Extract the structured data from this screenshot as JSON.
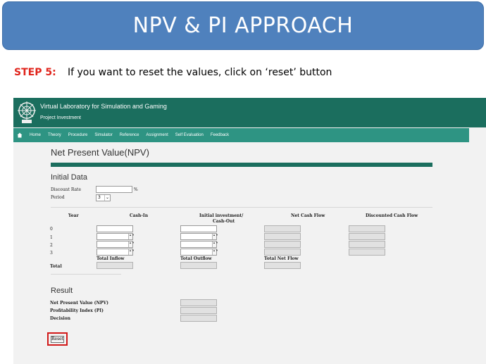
{
  "slide": {
    "banner_title": "NPV & PI APPROACH",
    "step_label": "STEP 5:",
    "step_text": "If you want to reset the values, click on ‘reset’ button"
  },
  "app": {
    "title": "Virtual Laboratory for Simulation and Gaming",
    "subtitle": "Project Investment",
    "nav": [
      "Home",
      "Theory",
      "Procedure",
      "Simulator",
      "Reference",
      "Assignment",
      "Self Evaluation",
      "Feedback"
    ]
  },
  "page": {
    "title": "Net Present Value(NPV)",
    "initial_data_heading": "Initial Data",
    "discount_rate_label": "Discount Rate",
    "discount_rate_value": "",
    "percent_sign": "%",
    "period_label": "Period",
    "period_value": "3",
    "table": {
      "col_year": "Year",
      "col_cashin": "Cash-In",
      "col_invest_line1": "Initial investment/",
      "col_invest_line2": "Cash-Out",
      "col_netcash": "Net Cash Flow",
      "col_discounted": "Discounted Cash Flow",
      "years": [
        "0",
        "1",
        "2",
        "3"
      ],
      "total_inflow": "Total Inflow",
      "total_outflow": "Total Outflow",
      "total_netflow": "Total Net Flow",
      "total_label": "Total"
    },
    "result_heading": "Result",
    "npv_label": "Net Present Value (NPV)",
    "pi_label": "Profitability Index (PI)",
    "decision_label": "Decision",
    "reset_label": "Reset"
  },
  "colors": {
    "banner": "#4f81bd",
    "step_label": "#e0241b",
    "header": "#1b6e5e",
    "nav": "#2e9483",
    "highlight": "#d11a1a"
  },
  "icons": {
    "home": "home-icon",
    "logo": "institute-logo"
  }
}
